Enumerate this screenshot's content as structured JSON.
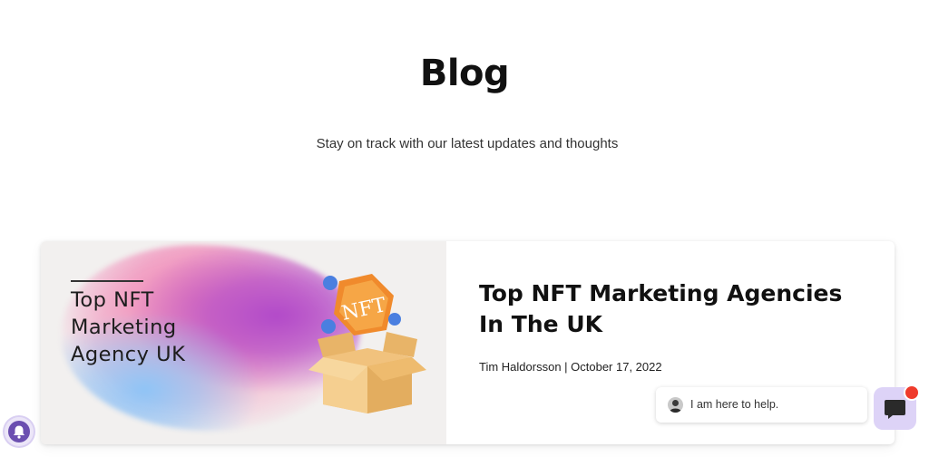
{
  "page": {
    "title": "Blog",
    "subtitle": "Stay on track with our latest updates and thoughts"
  },
  "featured_post": {
    "image_text_lines": [
      "Top NFT",
      "Marketing",
      "Agency UK"
    ],
    "image_badge_text": "NFT",
    "title": "Top NFT Marketing Agencies In The UK",
    "author": "Tim Haldorsson",
    "date": "October 17, 2022",
    "meta": "Tim Haldorsson | October 17, 2022"
  },
  "chat_widget": {
    "prompt": "I am here to help.",
    "accent_color": "#ddd3f7",
    "badge_color": "#ef3b2c",
    "icons": [
      "chat-icon",
      "agent-avatar"
    ]
  },
  "notification_widget": {
    "icon": "bell-icon"
  }
}
